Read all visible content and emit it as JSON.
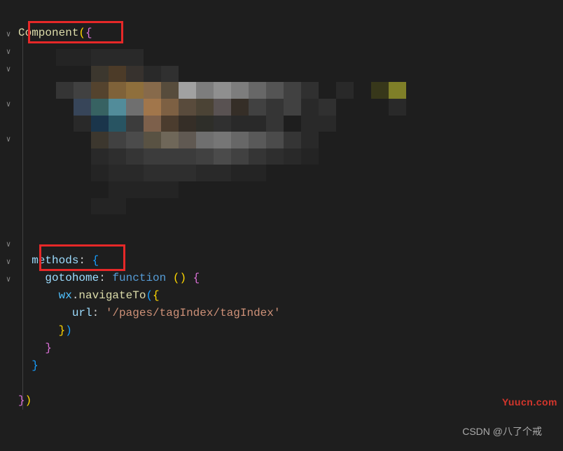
{
  "code": {
    "componentStart": "Component",
    "openParen": "(",
    "openBraceL1": "{",
    "methodsKey": "methods",
    "colon": ":",
    "space": " ",
    "openBraceL2": "{",
    "gotohomeKey": "gotohome",
    "functionKw": "function",
    "emptyParens": "()",
    "openBraceL3": "{",
    "wxVar": "wx",
    "dot": ".",
    "navigateTo": "navigateTo",
    "openParenInner": "(",
    "openBraceL4": "{",
    "urlKey": "url",
    "urlValue": "'/pages/tagIndex/tagIndex'",
    "closeBraceL4": "}",
    "closeParenInner": ")",
    "closeBraceL3": "}",
    "closeBraceL2": "}",
    "closeBraceL1": "}",
    "closeParen": ")"
  },
  "watermarks": {
    "bottom": "CSDN @八了个戒",
    "side": "Yuucn.com"
  }
}
